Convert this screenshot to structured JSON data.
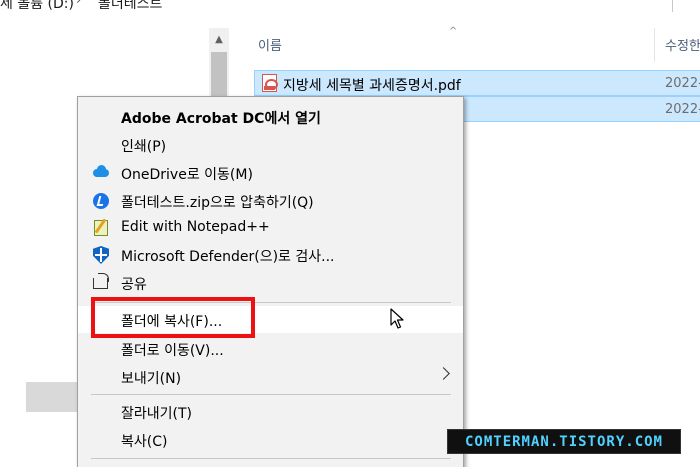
{
  "address_bar": {
    "drive": "세 볼륨 (D:)",
    "separator": "›",
    "folder": "폴더테스트"
  },
  "file_list": {
    "columns": {
      "name": "이름",
      "date": "수정한"
    },
    "sort_indicator": "^",
    "rows": [
      {
        "name": "지방세 세목별 과세증명서.pdf",
        "date": "2022-",
        "icon": "pdf-icon"
      },
      {
        "name": "",
        "date": "2022-",
        "icon": ""
      }
    ]
  },
  "context_menu": {
    "items": [
      {
        "label": "Adobe Acrobat DC에서 열기",
        "icon": ""
      },
      {
        "label": "인쇄(P)",
        "icon": ""
      },
      {
        "label": "OneDrive로 이동(M)",
        "icon": "onedrive-cloud-icon"
      },
      {
        "label": "폴더테스트.zip으로 압축하기(Q)",
        "icon": "zip-compress-icon"
      },
      {
        "label": "Edit with Notepad++",
        "icon": "notepad-plus-icon"
      },
      {
        "label": "Microsoft Defender(으)로 검사...",
        "icon": "defender-shield-icon"
      },
      {
        "label": "공유",
        "icon": "share-icon"
      },
      {
        "label": "폴더에 복사(F)...",
        "icon": ""
      },
      {
        "label": "폴더로 이동(V)...",
        "icon": ""
      },
      {
        "label": "보내기(N)",
        "icon": "chevron-right-icon"
      },
      {
        "label": "잘라내기(T)",
        "icon": ""
      },
      {
        "label": "복사(C)",
        "icon": ""
      }
    ]
  },
  "watermark": "COMTERMAN.TISTORY.COM",
  "colors": {
    "selection": "#cce8ff",
    "highlight_box": "#ee1111",
    "watermark_text": "#4fd2ff"
  }
}
